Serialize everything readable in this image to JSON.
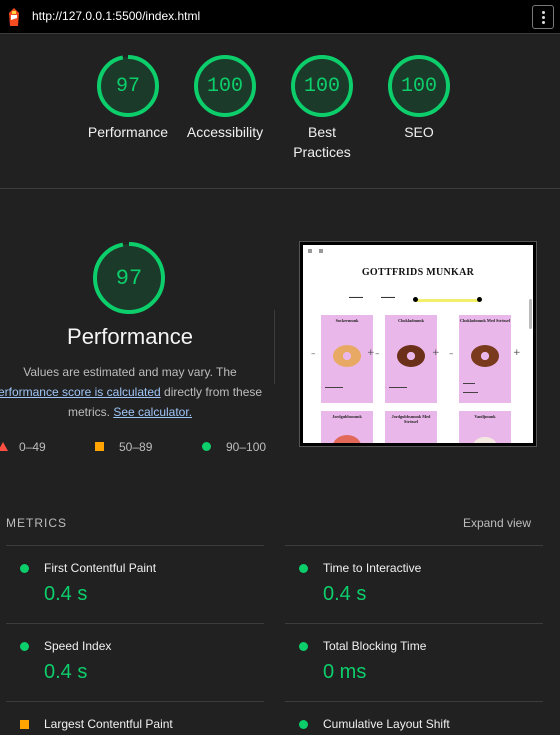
{
  "browser": {
    "url": "http://127.0.0.1:5500/index.html",
    "logo_icon": "lighthouse-icon",
    "menu_icon": "kebab-menu-icon"
  },
  "summary_scores": [
    {
      "label": "Performance",
      "score": "97"
    },
    {
      "label": "Accessibility",
      "score": "100"
    },
    {
      "label": "Best",
      "label2": "Practices",
      "score": "100"
    },
    {
      "label": "SEO",
      "score": "100"
    }
  ],
  "performance": {
    "score": "97",
    "title": "Performance",
    "desc_line1": "Values are estimated and may vary. The",
    "link_score": "erformance score is calculated",
    "desc_after_link": " directly from these",
    "desc_metrics": "metrics.",
    "link_calculator": "See calculator.",
    "legend": [
      {
        "range": "0–49",
        "shape": "triangle",
        "color": "#ff4e42"
      },
      {
        "range": "50–89",
        "shape": "square",
        "color": "#ffa400"
      },
      {
        "range": "90–100",
        "shape": "circle",
        "color": "#0cce6b"
      }
    ]
  },
  "screenshot": {
    "brand": "GOTTFRIDS MUNKAR",
    "cards": [
      {
        "name": "Sockermunk"
      },
      {
        "name": "Chokladmunk"
      },
      {
        "name": "Chokladmunk Med Strössel"
      },
      {
        "name": "Jordgubbsmunk"
      },
      {
        "name": "Jordgubbsmunk Med Strössel"
      },
      {
        "name": "Vaniljmunk"
      }
    ]
  },
  "metrics": {
    "heading": "METRICS",
    "expand_label": "Expand view",
    "items": [
      {
        "name": "First Contentful Paint",
        "value": "0.4 s",
        "status": "good"
      },
      {
        "name": "Time to Interactive",
        "value": "0.4 s",
        "status": "good"
      },
      {
        "name": "Speed Index",
        "value": "0.4 s",
        "status": "good"
      },
      {
        "name": "Total Blocking Time",
        "value": "0 ms",
        "status": "good"
      },
      {
        "name": "Largest Contentful Paint",
        "value": "",
        "status": "average"
      },
      {
        "name": "Cumulative Layout Shift",
        "value": "",
        "status": "good"
      }
    ]
  },
  "colors": {
    "good": "#0cce6b",
    "average": "#ffa400",
    "poor": "#ff4e42",
    "background": "#212121"
  }
}
